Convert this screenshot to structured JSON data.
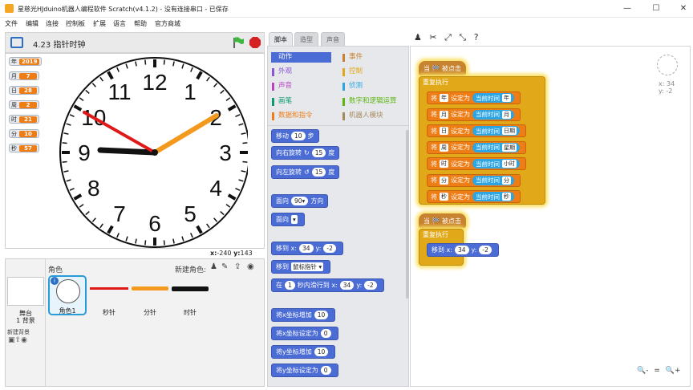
{
  "window": {
    "title": "星慈光HJduino机器人编程软件 Scratch(v4.1.2) - 没有连接串口 - 已保存",
    "controls": [
      "—",
      "☐",
      "✕"
    ]
  },
  "menu": [
    "文件",
    "编辑",
    "连接",
    "控制板",
    "扩展",
    "语言",
    "帮助",
    "官方商城"
  ],
  "stage": {
    "project_title": "4.23 指针时钟",
    "monitors": [
      {
        "label": "年",
        "value": "2019"
      },
      {
        "label": "月",
        "value": "7"
      },
      {
        "label": "日",
        "value": "28"
      },
      {
        "label": "周",
        "value": "2"
      },
      {
        "label": "时",
        "value": "21"
      },
      {
        "label": "分",
        "value": "10"
      },
      {
        "label": "秒",
        "value": "57"
      }
    ],
    "clock_numbers": [
      "12",
      "1",
      "2",
      "3",
      "4",
      "5",
      "6",
      "7",
      "8",
      "9",
      "10",
      "11"
    ],
    "coords": {
      "x_label": "x:",
      "x": "-240",
      "y_label": "y:",
      "y": "143"
    }
  },
  "sprites": {
    "header": "角色",
    "new_sprite": "新建角色:",
    "stage_label": "舞台",
    "stage_sub": "1 背景",
    "new_backdrop": "新建背景",
    "items": [
      {
        "name": "角色1",
        "selected": true
      },
      {
        "name": "秒针",
        "selected": false
      },
      {
        "name": "分针",
        "selected": false
      },
      {
        "name": "时针",
        "selected": false
      }
    ]
  },
  "palette": {
    "tabs": [
      "脚本",
      "造型",
      "声音"
    ],
    "categories_left": [
      {
        "label": "动作",
        "color": "#4a6cd4",
        "active": true
      },
      {
        "label": "外观",
        "color": "#8a55d7"
      },
      {
        "label": "声音",
        "color": "#bb42c3"
      },
      {
        "label": "画笔",
        "color": "#0e9a6c"
      },
      {
        "label": "数据和指令",
        "color": "#ee7d16"
      }
    ],
    "categories_right": [
      {
        "label": "事件",
        "color": "#c88330"
      },
      {
        "label": "控制",
        "color": "#e1a91a"
      },
      {
        "label": "侦测",
        "color": "#2ca5e2"
      },
      {
        "label": "数字和逻辑运算",
        "color": "#5cb712"
      },
      {
        "label": "机器人模块",
        "color": "#a58b5c"
      }
    ],
    "blocks": {
      "move": [
        "移动",
        "10",
        "步"
      ],
      "turn_right": [
        "向右旋转",
        "↻",
        "15",
        "度"
      ],
      "turn_left": [
        "向左旋转",
        "↺",
        "15",
        "度"
      ],
      "point_dir": [
        "面向",
        "90▾",
        "方向"
      ],
      "point_to": [
        "面向",
        "▾"
      ],
      "goto_xy": [
        "移到 x:",
        "34",
        "y:",
        "-2"
      ],
      "goto": [
        "移到",
        "鼠标指针 ▾"
      ],
      "glide": [
        "在",
        "1",
        "秒内滑行到 x:",
        "34",
        "y:",
        "-2"
      ],
      "change_x": [
        "将x坐标增加",
        "10"
      ],
      "set_x": [
        "将x坐标设定为",
        "0"
      ],
      "change_y": [
        "将y坐标增加",
        "10"
      ],
      "set_y": [
        "将y坐标设定为",
        "0"
      ]
    }
  },
  "script": {
    "hat1": "当 🏁 被点击",
    "forever1": "重复执行",
    "set_rows": [
      {
        "var": "年",
        "field": "年"
      },
      {
        "var": "月",
        "field": "月"
      },
      {
        "var": "日",
        "field": "日期"
      },
      {
        "var": "周",
        "field": "星期"
      },
      {
        "var": "时",
        "field": "小时"
      },
      {
        "var": "分",
        "field": "分"
      },
      {
        "var": "秒",
        "field": "秒"
      }
    ],
    "set_word_a": "将",
    "set_word_b": "设定为",
    "sensor_word": "当前时间",
    "hat2": "当 🏁 被点击",
    "forever2": "重复执行",
    "goto": [
      "移到 x:",
      "34",
      "y:",
      "-2"
    ],
    "corner": {
      "x": "x: 34",
      "y": "y: -2"
    },
    "zoom": [
      "🔍-",
      "=",
      "🔍+"
    ]
  }
}
